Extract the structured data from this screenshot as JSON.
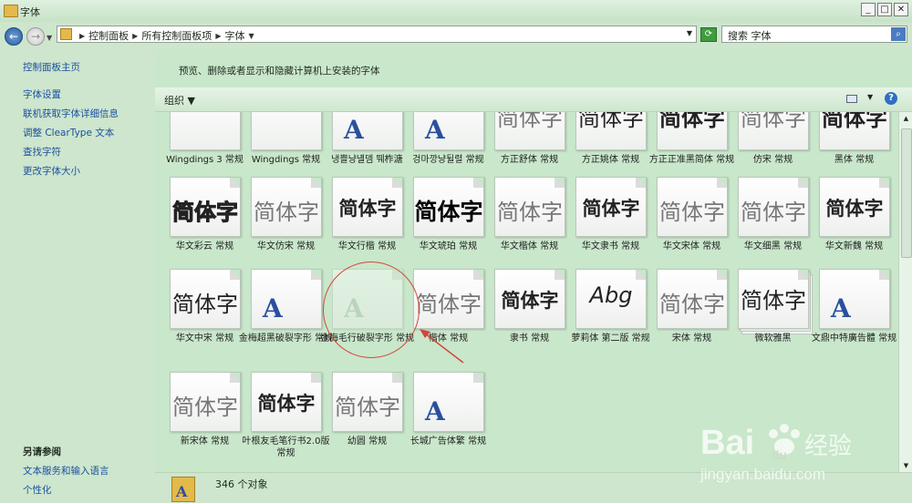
{
  "window": {
    "title": "字体"
  },
  "address": {
    "crumbs": [
      "控制面板",
      "所有控制面板项",
      "字体"
    ],
    "search": "搜索 字体"
  },
  "sidebar": {
    "links": [
      "控制面板主页",
      "字体设置",
      "联机获取字体详细信息",
      "调整 ClearType 文本",
      "查找字符",
      "更改字体大小"
    ],
    "see_also_heading": "另请参阅",
    "see_also": [
      "文本服务和输入语言",
      "个性化"
    ]
  },
  "main": {
    "description": "预览、删除或者显示和隐藏计算机上安装的字体",
    "organize": "组织"
  },
  "fonts": [
    {
      "sample": "",
      "caption": "Wingdings 3 常规"
    },
    {
      "sample": "",
      "caption": "Wingdings 常规"
    },
    {
      "sample": "A",
      "caption": "냉쁠냥녤뎀 뛔柞溏"
    },
    {
      "sample": "A",
      "caption": "겅마깡냥뒬렬 常规"
    },
    {
      "sample": "简体字",
      "caption": "方正舒体 常规"
    },
    {
      "sample": "简体字",
      "caption": "方正姚体 常规"
    },
    {
      "sample": "简体字",
      "caption": "方正正准黑简体 常规"
    },
    {
      "sample": "简体字",
      "caption": "仿宋 常规"
    },
    {
      "sample": "简体字",
      "caption": "黑体 常规"
    },
    {
      "sample": "简体字",
      "caption": "华文彩云 常规"
    },
    {
      "sample": "简体字",
      "caption": "华文仿宋 常规"
    },
    {
      "sample": "简体字",
      "caption": "华文行楷 常规"
    },
    {
      "sample": "简体字",
      "caption": "华文琥珀 常规"
    },
    {
      "sample": "简体字",
      "caption": "华文楷体 常规"
    },
    {
      "sample": "简体字",
      "caption": "华文隶书 常规"
    },
    {
      "sample": "简体字",
      "caption": "华文宋体 常规"
    },
    {
      "sample": "简体字",
      "caption": "华文细黑 常规"
    },
    {
      "sample": "简体字",
      "caption": "华文新魏 常规"
    },
    {
      "sample": "简体字",
      "caption": "华文中宋 常规"
    },
    {
      "sample": "A",
      "caption": "金梅超黑破裂字形 常规"
    },
    {
      "sample": "A",
      "caption": "金梅毛行破裂字形 常规"
    },
    {
      "sample": "简体字",
      "caption": "楷体 常规"
    },
    {
      "sample": "简体字",
      "caption": "隶书 常规"
    },
    {
      "sample": "Abg",
      "caption": "萝莉体 第二版 常规"
    },
    {
      "sample": "简体字",
      "caption": "宋体 常规"
    },
    {
      "sample": "简体字",
      "caption": "微软雅黑"
    },
    {
      "sample": "A",
      "caption": "文鼎中特廣告體 常规"
    },
    {
      "sample": "简体字",
      "caption": "新宋体 常规"
    },
    {
      "sample": "简体字",
      "caption": "叶根友毛笔行书2.0版 常规"
    },
    {
      "sample": "简体字",
      "caption": "幼圆 常规"
    },
    {
      "sample": "A",
      "caption": "长城广告体繁 常规"
    }
  ],
  "status": {
    "count": "346 个对象"
  },
  "watermark": {
    "brand_a": "Bai",
    "brand_b": "du",
    "cn": "经验",
    "url": "jingyan.baidu.com"
  }
}
